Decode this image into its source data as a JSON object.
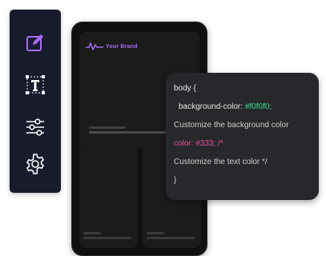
{
  "brand": {
    "name": "Your Brand",
    "color": "#a86bf0"
  },
  "toolbar": {
    "items": [
      {
        "icon": "edit-icon"
      },
      {
        "icon": "text-icon"
      },
      {
        "icon": "sliders-icon"
      },
      {
        "icon": "gear-icon"
      }
    ],
    "active_color": "#a86bf0"
  },
  "code": {
    "line1": "body {",
    "line2_prop": "background-color: ",
    "line2_value": "#f0f0f0;",
    "line3": "Customize the background color",
    "line4": "color: #333; /*",
    "line5": "Customize the text color */",
    "line6": "}",
    "value_color": "#37e08c",
    "highlight_color": "#e64ea1"
  }
}
